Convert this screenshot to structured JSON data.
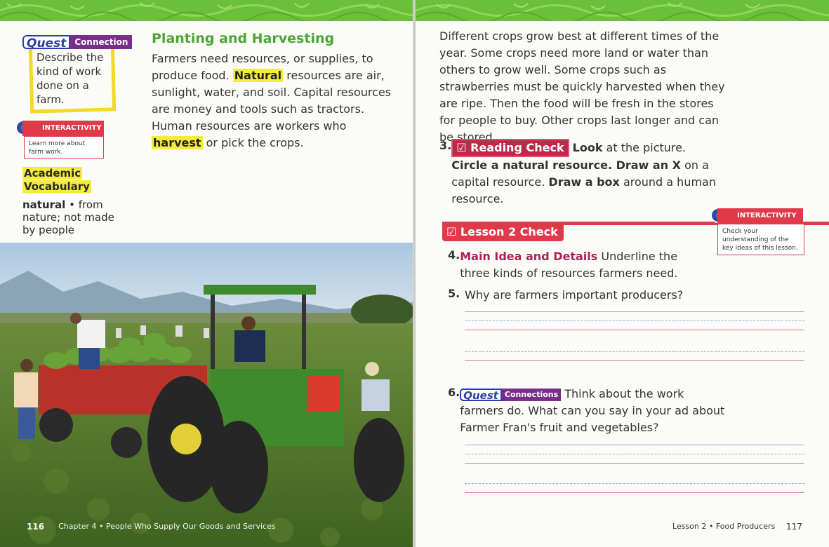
{
  "left_page": {
    "quest": {
      "word": "Quest",
      "label": "Connection",
      "text": "Describe the kind of work done on a farm."
    },
    "interactivity": {
      "title": "INTERACTIVITY",
      "text": "Learn more about farm work."
    },
    "academic": {
      "line1": "Academic",
      "line2": "Vocabulary"
    },
    "vocab": {
      "term": "natural",
      "sep": " • ",
      "definition": "from nature; not made by people"
    },
    "section_title": "Planting and Harvesting",
    "p1": "Farmers need resources, or supplies, to produce food.",
    "p1_hl": "Natural",
    "p2": "resources are air, sunlight, water, and soil. Capital resources are money and tools such as tractors. Human resources are workers who",
    "p2_hl": "harvest",
    "p3": "or pick the crops.",
    "footer": {
      "page": "116",
      "chapter": "Chapter 4",
      "sep": "•",
      "title": "People Who Supply Our Goods and Services"
    }
  },
  "right_page": {
    "intro": "Different crops grow best at different times of the year. Some crops need more land or water than others to grow well. Some crops such as strawberries must be quickly harvested when they are ripe. Then the food will be fresh in the stores for people to buy. Other crops last longer and can be stored.",
    "q3": {
      "num": "3.",
      "badge": "Reading Check",
      "b1": "Look",
      "t1": " at the picture. ",
      "b2": "Circle a natural resource. Draw an X",
      "t2": " on a capital resource. ",
      "b3": "Draw a box",
      "t3": " around a human resource."
    },
    "interactivity": {
      "title": "INTERACTIVITY",
      "text": "Check your understanding of the key ideas of this lesson."
    },
    "lesson_check": "Lesson 2 Check",
    "q4": {
      "num": "4.",
      "lead": "Main Idea and Details",
      "text": " Underline the three kinds of resources farmers need."
    },
    "q5": {
      "num": "5.",
      "text": "Why are farmers important producers?"
    },
    "q6": {
      "num": "6.",
      "quest_word": "Quest",
      "quest_label": "Connections",
      "text": " Think about the work farmers do. What can you say in your ad about Farmer Fran's fruit and vegetables?"
    },
    "footer": {
      "lesson": "Lesson 2",
      "sep": "•",
      "title": "Food Producers",
      "page": "117"
    }
  },
  "colors": {
    "banner_green": "#6cbf3a",
    "title_green": "#4aa534",
    "highlight": "#f4ec3c",
    "check_red": "#e03a4a",
    "quest_purple": "#7a2e8c",
    "quest_blue": "#2a3fa8"
  },
  "icons": {
    "hand": "hand-pointer-icon",
    "check": "checkmark-icon"
  }
}
